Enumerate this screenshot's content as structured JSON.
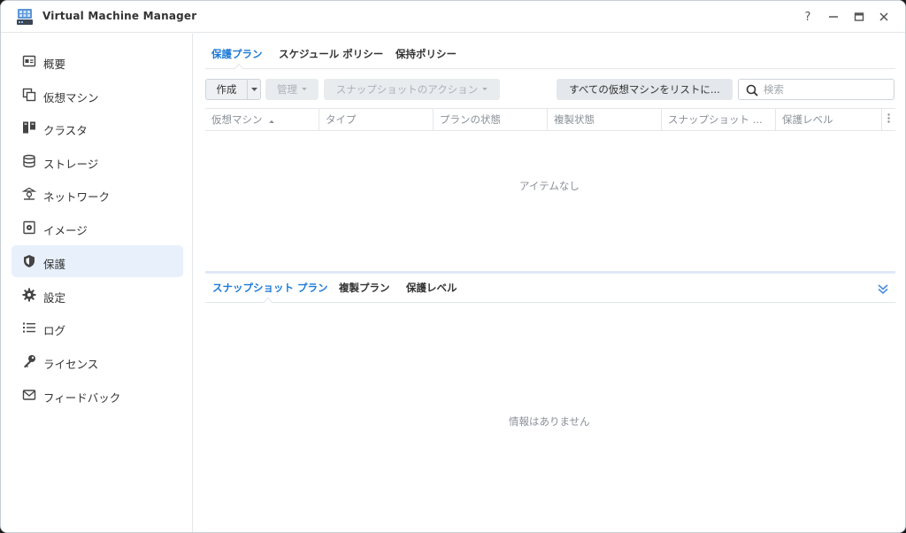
{
  "app": {
    "title": "Virtual Machine Manager",
    "accent_color": "#1f7ad6",
    "icon": "vmm-app-icon"
  },
  "window_controls": {
    "help": "?",
    "minimize": "–",
    "maximize": "▭",
    "close": "✕"
  },
  "sidebar": {
    "items": [
      {
        "label": "概要",
        "icon": "overview-icon",
        "active": false
      },
      {
        "label": "仮想マシン",
        "icon": "virtual-machine-icon",
        "active": false
      },
      {
        "label": "クラスタ",
        "icon": "cluster-icon",
        "active": false
      },
      {
        "label": "ストレージ",
        "icon": "storage-icon",
        "active": false
      },
      {
        "label": "ネットワーク",
        "icon": "network-icon",
        "active": false
      },
      {
        "label": "イメージ",
        "icon": "image-icon",
        "active": false
      },
      {
        "label": "保護",
        "icon": "shield-icon",
        "active": true
      },
      {
        "label": "設定",
        "icon": "gear-icon",
        "active": false
      },
      {
        "label": "ログ",
        "icon": "log-icon",
        "active": false
      },
      {
        "label": "ライセンス",
        "icon": "key-icon",
        "active": false
      },
      {
        "label": "フィードバック",
        "icon": "mail-icon",
        "active": false
      }
    ]
  },
  "top_tabs": {
    "items": [
      {
        "label": "保護プラン",
        "active": true
      },
      {
        "label": "スケジュール ポリシー",
        "active": false
      },
      {
        "label": "保持ポリシー",
        "active": false
      }
    ]
  },
  "toolbar": {
    "create_label": "作成",
    "manage_label": "管理",
    "snapshot_actions_label": "スナップショットのアクション",
    "list_all_label": "すべての仮想マシンをリストに...",
    "search_placeholder": "検索"
  },
  "grid": {
    "columns": [
      {
        "label": "仮想マシン",
        "sort": "asc"
      },
      {
        "label": "タイプ"
      },
      {
        "label": "プランの状態"
      },
      {
        "label": "複製状態"
      },
      {
        "label": "スナップショット ..."
      },
      {
        "label": "保護レベル"
      }
    ],
    "empty_text": "アイテムなし"
  },
  "bottom_tabs": {
    "items": [
      {
        "label": "スナップショット プラン",
        "active": true
      },
      {
        "label": "複製プラン",
        "active": false
      },
      {
        "label": "保護レベル",
        "active": false
      }
    ],
    "empty_text": "情報はありません"
  }
}
